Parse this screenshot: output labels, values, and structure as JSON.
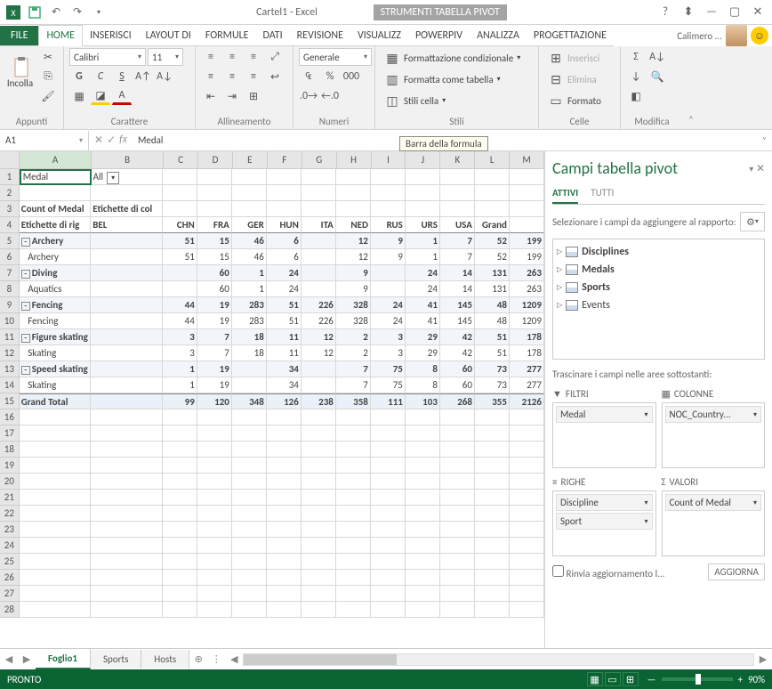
{
  "title": {
    "file": "Cartel1 - Excel",
    "pivot_tools": "STRUMENTI TABELLA PIVOT"
  },
  "titlebar": {
    "help": "?",
    "ribbon_toggle": "▾",
    "min": "—",
    "max": "▢",
    "close": "✕",
    "user": "Calimero ..."
  },
  "tabs": {
    "file": "FILE",
    "home": "HOME",
    "insert": "INSERISCI",
    "layout": "LAYOUT DI",
    "formulas": "FORMULE",
    "data": "DATI",
    "review": "REVISIONE",
    "view": "VISUALIZZ",
    "powerpiv": "POWERPIV",
    "analyze": "ANALIZZA",
    "design": "PROGETTAZIONE"
  },
  "ribbon": {
    "clipboard": {
      "paste": "Incolla",
      "label": "Appunti"
    },
    "font": {
      "name": "Calibri",
      "size": "11",
      "label": "Carattere"
    },
    "align": {
      "label": "Allineamento"
    },
    "number": {
      "format": "Generale",
      "label": "Numeri"
    },
    "styles": {
      "cond": "Formattazione condizionale",
      "table": "Formatta come tabella",
      "cell": "Stili cella",
      "label": "Stili"
    },
    "cells": {
      "insert": "Inserisci",
      "delete": "Elimina",
      "format": "Formato",
      "label": "Celle"
    },
    "editing": {
      "label": "Modifica"
    }
  },
  "formula_bar": {
    "name_box": "A1",
    "fx": "fx",
    "value": "Medal",
    "tooltip": "Barra della formula"
  },
  "pivot": {
    "filter_label": "Medal",
    "filter_value": "All",
    "count_label": "Count of Medal",
    "col_labels": "Etichette di col",
    "row_labels": "Etichette di rig",
    "headers": [
      "BEL",
      "CHN",
      "FRA",
      "GER",
      "HUN",
      "ITA",
      "NED",
      "RUS",
      "URS",
      "USA",
      "Grand Total"
    ],
    "rows": [
      {
        "label": "Archery",
        "lvl": 0,
        "exp": "-",
        "v": [
          "",
          "51",
          "15",
          "46",
          "6",
          "",
          "12",
          "9",
          "1",
          "7",
          "52",
          "199"
        ],
        "stripe": true,
        "bold": true
      },
      {
        "label": "Archery",
        "lvl": 1,
        "exp": "",
        "v": [
          "",
          "51",
          "15",
          "46",
          "6",
          "",
          "12",
          "9",
          "1",
          "7",
          "52",
          "199"
        ]
      },
      {
        "label": "Diving",
        "lvl": 0,
        "exp": "-",
        "v": [
          "",
          "",
          "60",
          "1",
          "24",
          "",
          "9",
          "",
          "24",
          "14",
          "131",
          "263"
        ],
        "stripe": true,
        "bold": true
      },
      {
        "label": "Aquatics",
        "lvl": 1,
        "exp": "",
        "v": [
          "",
          "",
          "60",
          "1",
          "24",
          "",
          "9",
          "",
          "24",
          "14",
          "131",
          "263"
        ]
      },
      {
        "label": "Fencing",
        "lvl": 0,
        "exp": "-",
        "v": [
          "",
          "44",
          "19",
          "283",
          "51",
          "226",
          "328",
          "24",
          "41",
          "145",
          "48",
          "1209"
        ],
        "stripe": true,
        "bold": true
      },
      {
        "label": "Fencing",
        "lvl": 1,
        "exp": "",
        "v": [
          "",
          "44",
          "19",
          "283",
          "51",
          "226",
          "328",
          "24",
          "41",
          "145",
          "48",
          "1209"
        ]
      },
      {
        "label": "Figure skating",
        "lvl": 0,
        "exp": "-",
        "v": [
          "",
          "3",
          "7",
          "18",
          "11",
          "12",
          "2",
          "3",
          "29",
          "42",
          "51",
          "178"
        ],
        "stripe": true,
        "bold": true
      },
      {
        "label": "Skating",
        "lvl": 1,
        "exp": "",
        "v": [
          "",
          "3",
          "7",
          "18",
          "11",
          "12",
          "2",
          "3",
          "29",
          "42",
          "51",
          "178"
        ]
      },
      {
        "label": "Speed skating",
        "lvl": 0,
        "exp": "-",
        "v": [
          "",
          "1",
          "19",
          "",
          "34",
          "",
          "7",
          "75",
          "8",
          "60",
          "73",
          "277"
        ],
        "stripe": true,
        "bold": true
      },
      {
        "label": "Skating",
        "lvl": 1,
        "exp": "",
        "v": [
          "",
          "1",
          "19",
          "",
          "34",
          "",
          "7",
          "75",
          "8",
          "60",
          "73",
          "277"
        ]
      }
    ],
    "grand_total": {
      "label": "Grand Total",
      "v": [
        "",
        "99",
        "120",
        "348",
        "126",
        "238",
        "358",
        "111",
        "103",
        "268",
        "355",
        "2126"
      ]
    }
  },
  "pane": {
    "title": "Campi tabella pivot",
    "tab_active": "ATTIVI",
    "tab_all": "TUTTI",
    "hint": "Selezionare i campi da aggiungere al rapporto:",
    "tables": [
      "Disciplines",
      "Medals",
      "Sports",
      "Events"
    ],
    "drag_hint": "Trascinare i campi nelle aree sottostanti:",
    "areas": {
      "filters": {
        "label": "FILTRI",
        "items": [
          "Medal"
        ]
      },
      "columns": {
        "label": "COLONNE",
        "items": [
          "NOC_Country..."
        ]
      },
      "rows": {
        "label": "RIGHE",
        "items": [
          "Discipline",
          "Sport"
        ]
      },
      "values": {
        "label": "VALORI",
        "items": [
          "Count of Medal"
        ]
      }
    },
    "defer": "Rinvia aggiornamento l...",
    "update": "AGGIORNA"
  },
  "sheettabs": {
    "s1": "Foglio1",
    "s2": "Sports",
    "s3": "Hosts"
  },
  "status": {
    "ready": "PRONTO",
    "zoom": "90%"
  },
  "cols": [
    "A",
    "B",
    "C",
    "D",
    "E",
    "F",
    "G",
    "H",
    "I",
    "J",
    "K",
    "L",
    "M"
  ]
}
